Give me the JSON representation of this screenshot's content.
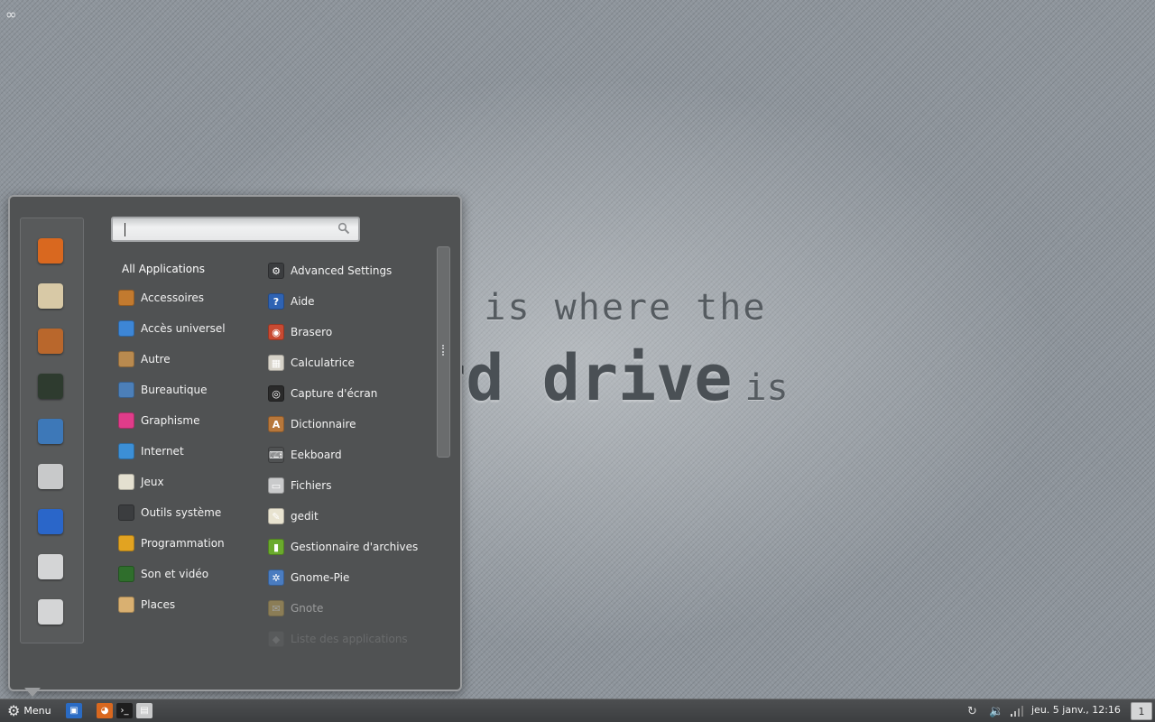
{
  "desktop": {
    "corner_icon": "∞",
    "wallpaper_line1": "home is where the",
    "wallpaper_big": "hard drive",
    "wallpaper_small": "is"
  },
  "menu": {
    "favorites": [
      {
        "name": "firefox-icon",
        "color": "#d9681f"
      },
      {
        "name": "mail-icon",
        "color": "#d8c9a6"
      },
      {
        "name": "speaker-icon",
        "color": "#b9672c"
      },
      {
        "name": "globe-icon",
        "color": "#2e3b2f"
      },
      {
        "name": "document-icon",
        "color": "#3d78b8"
      },
      {
        "name": "file-cabinet-icon",
        "color": "#c8c9ca"
      },
      {
        "name": "lock-screen-icon",
        "color": "#2a66c9"
      },
      {
        "name": "logout-icon",
        "color": "#d4d5d6"
      },
      {
        "name": "power-icon",
        "color": "#d4d5d6"
      }
    ],
    "search": {
      "value": "",
      "placeholder": ""
    },
    "all_applications": "All Applications",
    "categories": [
      {
        "label": "Accessoires",
        "icon": "accessories-icon",
        "color": "#c27a2f"
      },
      {
        "label": "Accès universel",
        "icon": "accessibility-icon",
        "color": "#3d86d6"
      },
      {
        "label": "Autre",
        "icon": "other-icon",
        "color": "#b98a4f"
      },
      {
        "label": "Bureautique",
        "icon": "office-icon",
        "color": "#4c7fb8"
      },
      {
        "label": "Graphisme",
        "icon": "graphics-icon",
        "color": "#e03c8a"
      },
      {
        "label": "Internet",
        "icon": "internet-icon",
        "color": "#3c8fd6"
      },
      {
        "label": "Jeux",
        "icon": "games-icon",
        "color": "#e4e0d0"
      },
      {
        "label": "Outils système",
        "icon": "system-tools-icon",
        "color": "#3b3d3f"
      },
      {
        "label": "Programmation",
        "icon": "programming-icon",
        "color": "#e2a321"
      },
      {
        "label": "Son et vidéo",
        "icon": "multimedia-icon",
        "color": "#2f6e2c"
      },
      {
        "label": "Places",
        "icon": "folder-icon",
        "color": "#d9b071"
      }
    ],
    "apps": [
      {
        "label": "Advanced Settings",
        "icon": "settings-icon",
        "color": "#3b3d3f",
        "glyph": "⚙"
      },
      {
        "label": "Aide",
        "icon": "help-icon",
        "color": "#2f63b3",
        "glyph": "?"
      },
      {
        "label": "Brasero",
        "icon": "brasero-icon",
        "color": "#c84a32",
        "glyph": "◉"
      },
      {
        "label": "Calculatrice",
        "icon": "calculator-icon",
        "color": "#d6d2c8",
        "glyph": "▦"
      },
      {
        "label": "Capture d'écran",
        "icon": "screenshot-icon",
        "color": "#2a2a2a",
        "glyph": "◎"
      },
      {
        "label": "Dictionnaire",
        "icon": "dictionary-icon",
        "color": "#b7773b",
        "glyph": "A"
      },
      {
        "label": "Eekboard",
        "icon": "keyboard-icon",
        "color": "#505253",
        "glyph": "⌨"
      },
      {
        "label": "Fichiers",
        "icon": "files-icon",
        "color": "#c9cacb",
        "glyph": "▭"
      },
      {
        "label": "gedit",
        "icon": "gedit-icon",
        "color": "#e8e3d0",
        "glyph": "✎"
      },
      {
        "label": "Gestionnaire d'archives",
        "icon": "archive-icon",
        "color": "#6aaa2c",
        "glyph": "▮"
      },
      {
        "label": "Gnome-Pie",
        "icon": "gnome-pie-icon",
        "color": "#4a7cc0",
        "glyph": "✲"
      },
      {
        "label": "Gnote",
        "icon": "gnote-icon",
        "color": "#d4b35a",
        "glyph": "✉"
      },
      {
        "label": "Liste des applications",
        "icon": "app-list-icon",
        "color": "#8a8c8e",
        "glyph": "◆"
      }
    ]
  },
  "panel": {
    "menu_label": "Menu",
    "launchers": [
      {
        "name": "show-desktop-icon",
        "color": "#2a6bc4",
        "glyph": "▣"
      },
      {
        "name": "firefox-launcher-icon",
        "color": "#d9681f",
        "glyph": "◕"
      },
      {
        "name": "terminal-launcher-icon",
        "color": "#1e1e1e",
        "glyph": "›_"
      },
      {
        "name": "files-launcher-icon",
        "color": "#c8c9ca",
        "glyph": "▤"
      }
    ],
    "clock": "jeu.  5 janv., 12:16",
    "workspace": "1"
  }
}
